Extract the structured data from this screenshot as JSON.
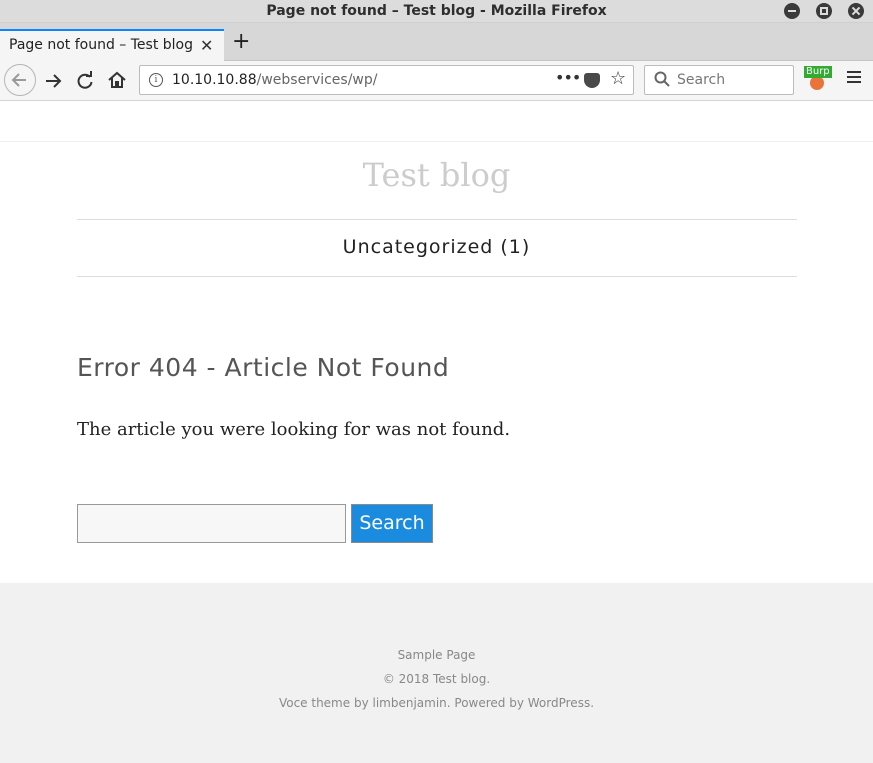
{
  "window": {
    "title": "Page not found – Test blog - Mozilla Firefox"
  },
  "tabs": [
    {
      "label": "Page not found – Test blog",
      "close_glyph": "✕"
    }
  ],
  "toolbar": {
    "new_tab_glyph": "+",
    "back_icon": "arrow-left-icon",
    "forward_icon": "arrow-right-icon",
    "reload_icon": "reload-icon",
    "home_icon": "home-icon",
    "url_host": "10.10.10.88",
    "url_path": "/webservices/wp/",
    "page_actions_glyph": "•••",
    "search_placeholder": "Search",
    "burp_badge": "Burp"
  },
  "blog": {
    "title": "Test blog",
    "nav_category": "Uncategorized (1)"
  },
  "content": {
    "heading": "Error 404 - Article Not Found",
    "message": "The article you were looking for was not found.",
    "search_value": "",
    "search_button": "Search"
  },
  "footer": {
    "sample_page": "Sample Page",
    "copyright": "© 2018 Test blog.",
    "credits_prefix": "Voce theme by ",
    "credits_author": "limbenjamin",
    "credits_middle": ". Powered by ",
    "credits_wp": "WordPress",
    "credits_suffix": "."
  },
  "colors": {
    "tab_accent": "#0a84ff",
    "search_button_bg": "#1b8be0",
    "footer_bg": "#f1f1f1"
  }
}
